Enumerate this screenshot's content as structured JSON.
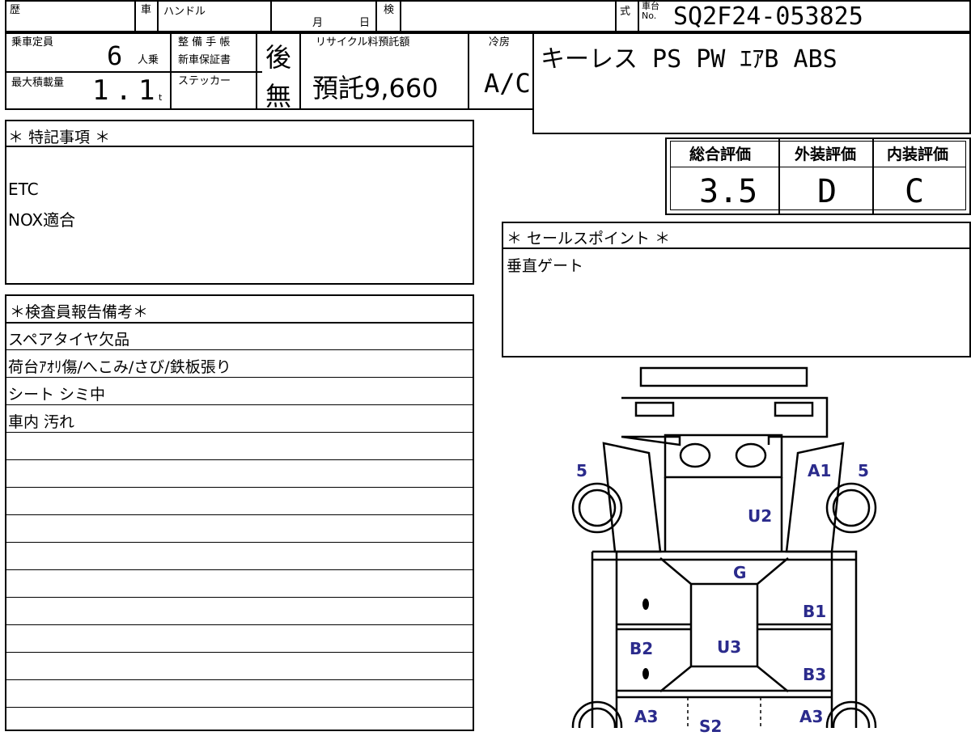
{
  "header": {
    "reki_label": "歴",
    "sha_label": "車",
    "handle_label": "ハンドル",
    "month_label": "月",
    "day_label": "日",
    "ken_label": "検",
    "shiki_label": "式",
    "chassis_no_label_1": "車台",
    "chassis_no_label_2": "No.",
    "chassis_no": "SQ2F24-053825"
  },
  "specs": {
    "capacity_label": "乗車定員",
    "capacity_value": "6",
    "capacity_unit": "人乗",
    "load_label": "最大積載量",
    "load_value": "1.1",
    "load_unit": "t",
    "maint_label_1": "整 備 手 帳",
    "maint_label_2": "新車保証書",
    "maint_value": "後",
    "sticker_label": "ステッカー",
    "sticker_value": "無",
    "recycle_label": "リサイクル料預託額",
    "recycle_value": "預託9,660",
    "cooler_label": "冷房",
    "cooler_value": "A/C",
    "equipment": "キーレス PS PW ｴｱB ABS"
  },
  "special_notes": {
    "title": "＊ 特記事項 ＊",
    "items": [
      "ETC",
      "NOX適合"
    ]
  },
  "grades": {
    "overall_label": "総合評価",
    "overall_value": "3.5",
    "exterior_label": "外装評価",
    "exterior_value": "D",
    "interior_label": "内装評価",
    "interior_value": "C"
  },
  "sales_point": {
    "title": "＊ セールスポイント ＊",
    "text": "垂直ゲート"
  },
  "inspector_report": {
    "title": "＊検査員報告備考＊",
    "lines": [
      "スペアタイヤ欠品",
      "荷台ｱｵﾘ傷/へこみ/さび/鉄板張り",
      "シート シミ中",
      "車内 汚れ"
    ]
  },
  "diagram": {
    "labels": {
      "l5": "5",
      "a1": "A1",
      "r5": "5",
      "u2": "U2",
      "g": "G",
      "b1": "B1",
      "b2": "B2",
      "u3": "U3",
      "b3": "B3",
      "a3_left": "A3",
      "a3_right": "A3",
      "s2": "S2"
    },
    "label_color": "#2b2b8c"
  }
}
